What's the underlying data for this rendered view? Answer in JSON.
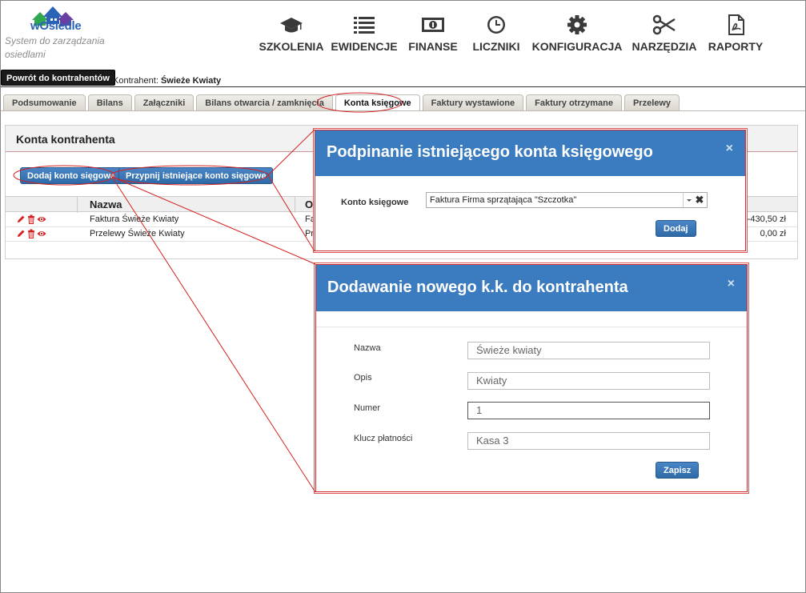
{
  "app": {
    "logo_text": "wOsiedle",
    "tagline": "System do zarządzania osiedlami"
  },
  "nav": [
    {
      "label": "SZKOLENIA",
      "icon": "graduation-cap-icon"
    },
    {
      "label": "EWIDENCJE",
      "icon": "list-icon"
    },
    {
      "label": "FINANSE",
      "icon": "banknote-icon"
    },
    {
      "label": "LICZNIKI",
      "icon": "clock-icon"
    },
    {
      "label": "KONFIGURACJA",
      "icon": "gear-icon"
    },
    {
      "label": "NARZĘDZIA",
      "icon": "scissors-icon"
    },
    {
      "label": "RAPORTY",
      "icon": "pdf-icon"
    }
  ],
  "toolbar": {
    "back_label": "Powrót do kontrahentów",
    "contractor_prefix": "Kontrahent:",
    "contractor_name": "Świeże Kwiaty"
  },
  "tabs": [
    {
      "label": "Podsumowanie",
      "active": false
    },
    {
      "label": "Bilans",
      "active": false
    },
    {
      "label": "Załączniki",
      "active": false
    },
    {
      "label": "Bilans otwarcia / zamknięcia",
      "active": false
    },
    {
      "label": "Konta księgowe",
      "active": true
    },
    {
      "label": "Faktury wystawione",
      "active": false
    },
    {
      "label": "Faktury otrzymane",
      "active": false
    },
    {
      "label": "Przelewy",
      "active": false
    }
  ],
  "panel": {
    "title": "Konta kontrahenta",
    "add_label": "Dodaj konto sięgowe",
    "attach_label": "Przypnij istniejące konto sięgowe",
    "columns": [
      "Nazwa",
      "O"
    ],
    "rows": [
      {
        "name": "Faktura Świeże Kwiaty",
        "op": "Fa",
        "amount": "-430,50 zł"
      },
      {
        "name": "Przelewy Świeże Kwiaty",
        "op": "Pr",
        "amount": "0,00 zł"
      }
    ]
  },
  "modal_attach": {
    "title": "Podpinanie istniejącego konta księgowego",
    "close": "×",
    "field_label": "Konto księgowe",
    "field_value": "Faktura Firma sprzątająca \"Szczotka\"",
    "submit": "Dodaj"
  },
  "modal_add": {
    "title": "Dodawanie nowego k.k. do kontrahenta",
    "close": "×",
    "fields": [
      {
        "label": "Nazwa",
        "value": "Świeże kwiaty"
      },
      {
        "label": "Opis",
        "value": "Kwiaty"
      },
      {
        "label": "Numer",
        "value": "1"
      },
      {
        "label": "Klucz płatności",
        "value": "Kasa 3"
      }
    ],
    "submit": "Zapisz"
  },
  "colors": {
    "accent": "#3a7cbf",
    "callout": "#d42020",
    "action_icon": "#d42020"
  }
}
